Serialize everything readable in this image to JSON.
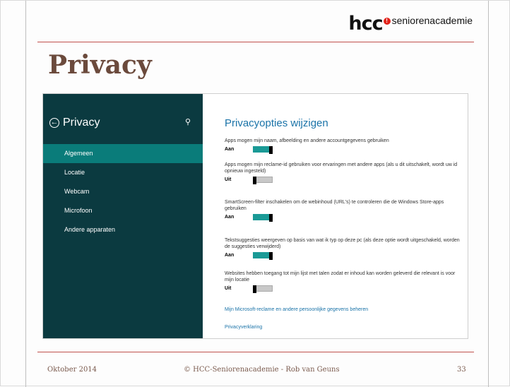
{
  "logo": {
    "brand": "hcc",
    "badge": "!",
    "name": "seniorenacademie"
  },
  "slide_title": "Privacy",
  "sidebar": {
    "title": "Privacy",
    "items": [
      {
        "label": "Algemeen",
        "active": true
      },
      {
        "label": "Locatie",
        "active": false
      },
      {
        "label": "Webcam",
        "active": false
      },
      {
        "label": "Microfoon",
        "active": false
      },
      {
        "label": "Andere apparaten",
        "active": false
      }
    ]
  },
  "content": {
    "title": "Privacyopties wijzigen",
    "options": [
      {
        "desc": "Apps mogen mijn naam, afbeelding en andere accountgegevens gebruiken",
        "state": "Aan",
        "on": true
      },
      {
        "desc": "Apps mogen mijn reclame-id gebruiken voor ervaringen met andere apps (als u dit uitschakelt, wordt uw id opnieuw ingesteld)",
        "state": "Uit",
        "on": false
      },
      {
        "desc": "SmartScreen-filter inschakelen om de webinhoud (URL's) te controleren die de Windows Store-apps gebruiken",
        "state": "Aan",
        "on": true
      },
      {
        "desc": "Tekstsuggesties weergeven op basis van wat ik typ op deze pc (als deze optie wordt uitgeschakeld, worden de suggesties verwijderd)",
        "state": "Aan",
        "on": true
      },
      {
        "desc": "Websites hebben toegang tot mijn lijst met talen zodat er inhoud kan worden geleverd die relevant is voor mijn locatie",
        "state": "Uit",
        "on": false
      }
    ],
    "links": [
      "Mijn Microsoft-reclame en andere persoonlijke gegevens beheren",
      "Privacyverklaring"
    ]
  },
  "footer": {
    "date": "Oktober 2014",
    "credit": "© HCC-Seniorenacademie - Rob van Geuns",
    "page": "33"
  },
  "colors": {
    "accent": "#c0504d",
    "title": "#6b4a3c",
    "sidebar": "#0b3a40",
    "sidebar_active": "#0a7c7a",
    "toggle_on": "#1a9a96",
    "link": "#1a73a8"
  }
}
